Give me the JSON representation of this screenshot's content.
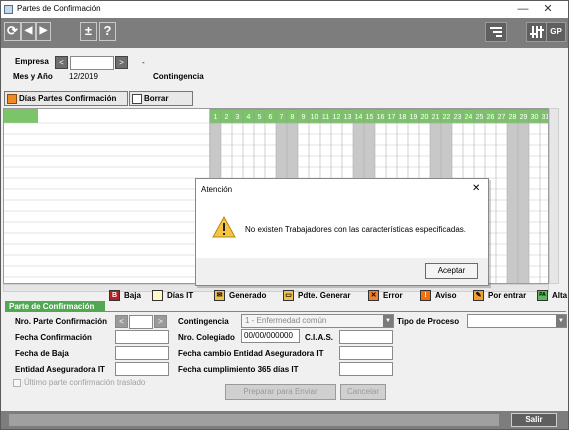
{
  "window": {
    "title": "Partes de Confirmación",
    "minimize": "—",
    "close": "✕"
  },
  "toolbar": {
    "refresh": "⟳",
    "prev": "◀",
    "next": "▶",
    "plusminus": "±",
    "help": "?",
    "gp": "GP"
  },
  "empresa": {
    "label": "Empresa",
    "prev": "<",
    "next": ">",
    "value": "",
    "dash": "-"
  },
  "mes_anio": {
    "label": "Mes y Año",
    "value": "12/2019"
  },
  "contingencia_top": {
    "label": "Contingencia"
  },
  "actions": {
    "dias_partes": "Días Partes Confirmación",
    "borrar": "Borrar"
  },
  "day_grid": {
    "days": [
      "1",
      "2",
      "3",
      "4",
      "5",
      "6",
      "7",
      "8",
      "9",
      "10",
      "11",
      "12",
      "13",
      "14",
      "15",
      "16",
      "17",
      "18",
      "19",
      "20",
      "21",
      "22",
      "23",
      "24",
      "25",
      "26",
      "27",
      "28",
      "29",
      "30",
      "31"
    ],
    "shaded_days": [
      1,
      7,
      8,
      14,
      15,
      21,
      22,
      28,
      29
    ],
    "empty_rows": 14,
    "header_color": "#7cc46a",
    "shade_color": "#c8c8c8"
  },
  "legend": [
    {
      "label": "Baja",
      "symbol": "B",
      "color": "#b22222",
      "text_color": "#fff"
    },
    {
      "label": "Días IT",
      "symbol": "",
      "color": "#fff7c8",
      "text_color": "#000"
    },
    {
      "label": "Generado",
      "symbol": "✉",
      "color": "#f0c050",
      "text_color": "#000"
    },
    {
      "label": "Pdte. Generar",
      "symbol": "▭",
      "color": "#f0c050",
      "text_color": "#000"
    },
    {
      "label": "Error",
      "symbol": "✕",
      "color": "#f08030",
      "text_color": "#000"
    },
    {
      "label": "Aviso",
      "symbol": "!",
      "color": "#f07010",
      "text_color": "#fff"
    },
    {
      "label": "Por entrar",
      "symbol": "✎",
      "color": "#f0a030",
      "text_color": "#000"
    },
    {
      "label": "Alta",
      "symbol": "PA",
      "color": "#5cb85c",
      "text_color": "#000"
    }
  ],
  "section": {
    "title": "Parte de Confirmación"
  },
  "form": {
    "nro_parte": {
      "label": "Nro. Parte Confirmación",
      "prev": "<",
      "next": ">",
      "value": ""
    },
    "contingencia": {
      "label": "Contingencia",
      "value": "1 - Enfermedad común",
      "arrow": "▼"
    },
    "tipo_proceso": {
      "label": "Tipo de Proceso",
      "value": "",
      "arrow": "▼"
    },
    "fecha_confirmacion": {
      "label": "Fecha Confirmación",
      "value": ""
    },
    "nro_colegiado": {
      "label": "Nro. Colegiado",
      "value": "00/00/000000"
    },
    "cias": {
      "label": "C.I.A.S.",
      "value": ""
    },
    "fecha_baja": {
      "label": "Fecha de Baja",
      "value": ""
    },
    "fecha_cambio": {
      "label": "Fecha cambio Entidad Aseguradora IT",
      "value": ""
    },
    "entidad_aseguradora": {
      "label": "Entidad Aseguradora IT",
      "value": ""
    },
    "fecha_cumplimiento": {
      "label": "Fecha cumplimiento 365 días IT",
      "value": ""
    },
    "ultimo_parte": {
      "label": "Último parte confirmación traslado"
    }
  },
  "buttons": {
    "preparar": "Preparar para Enviar",
    "cancelar": "Cancelar",
    "salir": "Salir"
  },
  "dialog": {
    "title": "Atención",
    "close": "✕",
    "message": "No existen Trabajadores con las características especificadas.",
    "accept": "Aceptar"
  }
}
